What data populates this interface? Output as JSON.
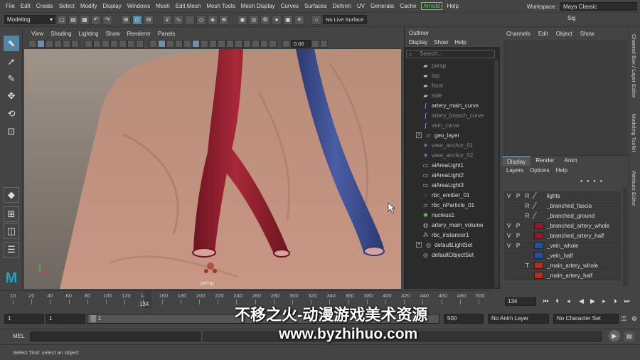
{
  "menubar": {
    "items": [
      "File",
      "Edit",
      "Create",
      "Select",
      "Modify",
      "Display",
      "Windows",
      "Mesh",
      "Edit Mesh",
      "Mesh Tools",
      "Mesh Display",
      "Curves",
      "Surfaces",
      "Deform",
      "UV",
      "Generate",
      "Cache"
    ],
    "arnold": "Arnold",
    "help": "Help",
    "workspace_label": "Workspace :",
    "workspace_value": "Maya Classic"
  },
  "shelf": {
    "mode": "Modeling",
    "live_surface": "No Live Surface",
    "sign_in": "Sig"
  },
  "viewport": {
    "menu": [
      "View",
      "Shading",
      "Lighting",
      "Show",
      "Renderer",
      "Panels"
    ],
    "camera_label": "persp",
    "exposure": "0.00",
    "artery_color": "#8b1c2c",
    "vein_color": "#3a4a8a"
  },
  "outliner": {
    "title": "Outliner",
    "menu": [
      "Display",
      "Show",
      "Help"
    ],
    "search_placeholder": "Search...",
    "items": [
      {
        "label": "persp",
        "icon": "camera-icon",
        "dim": true
      },
      {
        "label": "top",
        "icon": "camera-icon",
        "dim": true
      },
      {
        "label": "front",
        "icon": "camera-icon",
        "dim": true
      },
      {
        "label": "side",
        "icon": "camera-icon",
        "dim": true
      },
      {
        "label": "artery_main_curve",
        "icon": "curve-icon",
        "dim": false
      },
      {
        "label": "artery_branch_curve",
        "icon": "curve-icon",
        "dim": true
      },
      {
        "label": "vein_curve",
        "icon": "curve-icon",
        "dim": true
      },
      {
        "label": "geo_layer",
        "icon": "group-icon",
        "dim": false,
        "expand": true
      },
      {
        "label": "view_anchor_01",
        "icon": "locator-icon",
        "dim": true
      },
      {
        "label": "view_anchor_02",
        "icon": "locator-icon",
        "dim": true
      },
      {
        "label": "aiAreaLight1",
        "icon": "light-icon",
        "dim": false
      },
      {
        "label": "aiAreaLight2",
        "icon": "light-icon",
        "dim": false
      },
      {
        "label": "aiAreaLight3",
        "icon": "light-icon",
        "dim": false
      },
      {
        "label": "rbc_emitter_01",
        "icon": "emitter-icon",
        "dim": false
      },
      {
        "label": "rbc_nParticle_01",
        "icon": "particle-icon",
        "dim": false
      },
      {
        "label": "nucleus1",
        "icon": "nucleus-icon",
        "dim": false
      },
      {
        "label": "artery_main_volume",
        "icon": "volume-icon",
        "dim": false
      },
      {
        "label": "rbc_instancer1",
        "icon": "instancer-icon",
        "dim": false
      },
      {
        "label": "defaultLightSet",
        "icon": "set-icon",
        "dim": false,
        "expand": true
      },
      {
        "label": "defaultObjectSet",
        "icon": "set-icon",
        "dim": false
      }
    ]
  },
  "channel_box": {
    "menu": [
      "Channels",
      "Edit",
      "Object",
      "Show"
    ]
  },
  "layer_editor": {
    "tabs": [
      "Display",
      "Render",
      "Anim"
    ],
    "menu": [
      "Layers",
      "Options",
      "Help"
    ],
    "rows": [
      {
        "v": "V",
        "p": "P",
        "r": "R",
        "name": "lights",
        "color": ""
      },
      {
        "v": "",
        "p": "",
        "r": "R",
        "name": "_branched_fascia",
        "color": ""
      },
      {
        "v": "",
        "p": "",
        "r": "R",
        "name": "_branched_ground",
        "color": ""
      },
      {
        "v": "V",
        "p": "P",
        "r": "",
        "name": "_branched_artery_whole",
        "color": "#8b1c2c"
      },
      {
        "v": "V",
        "p": "P",
        "r": "",
        "name": "_branched_artery_half",
        "color": "#8b1c2c"
      },
      {
        "v": "V",
        "p": "P",
        "r": "",
        "name": "_vein_whole",
        "color": "#2a4f9a"
      },
      {
        "v": "",
        "p": "",
        "r": "",
        "name": "_vein_half",
        "color": "#2a4f9a"
      },
      {
        "v": "",
        "p": "",
        "r": "T",
        "name": "_main_artery_whole",
        "color": "#b03020"
      },
      {
        "v": "",
        "p": "",
        "r": "",
        "name": "_main_artery_half",
        "color": "#b03020"
      }
    ]
  },
  "side_tabs": [
    "Channel Box / Layer Editor",
    "Modeling Toolkit",
    "Attribute Editor"
  ],
  "timeline": {
    "ticks": [
      "10",
      "20",
      "40",
      "60",
      "80",
      "100",
      "120",
      "140",
      "160",
      "180",
      "200",
      "220",
      "240",
      "260",
      "280",
      "300",
      "320",
      "340",
      "360",
      "380",
      "400",
      "420",
      "440",
      "460",
      "480",
      "500"
    ],
    "current_frame": "134",
    "current_frame_field": "134"
  },
  "range": {
    "start": "1",
    "start_inner": "1",
    "slider_value": "1",
    "end": "500",
    "anim_layer": "No Anim Layer",
    "character_set": "No Character Set"
  },
  "mel": {
    "label": "MEL"
  },
  "status": {
    "help_line": "Select Tool: select an object"
  },
  "watermark": {
    "line1": "不移之火-动漫游戏美术资源",
    "line2": "www.byzhihuo.com"
  }
}
